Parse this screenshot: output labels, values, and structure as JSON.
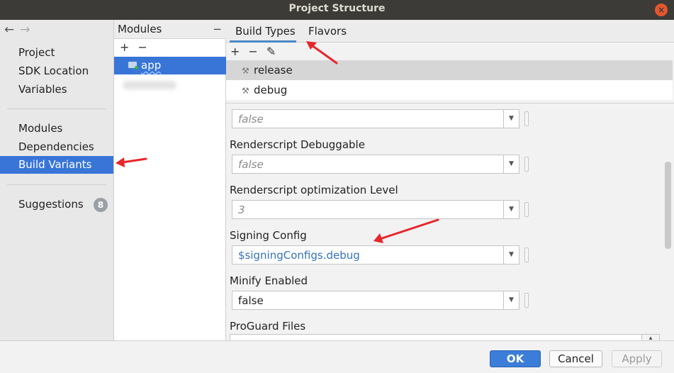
{
  "window": {
    "title": "Project Structure",
    "close_glyph": "×"
  },
  "nav": {
    "back_glyph": "←",
    "forward_glyph": "→",
    "items": [
      {
        "label": "Project"
      },
      {
        "label": "SDK Location"
      },
      {
        "label": "Variables"
      },
      {
        "label": "Modules"
      },
      {
        "label": "Dependencies"
      },
      {
        "label": "Build Variants",
        "selected": true
      },
      {
        "label": "Suggestions",
        "badge": "8"
      }
    ]
  },
  "modules": {
    "header": "Modules",
    "collapse_glyph": "−",
    "add_glyph": "+",
    "remove_glyph": "−",
    "items": [
      {
        "label": "app",
        "selected": true
      }
    ]
  },
  "tabs": [
    {
      "label": "Build Types",
      "active": true
    },
    {
      "label": "Flavors"
    }
  ],
  "build_types": {
    "add_glyph": "+",
    "remove_glyph": "−",
    "edit_glyph": "✎",
    "items": [
      {
        "label": "release",
        "selected": true
      },
      {
        "label": "debug"
      }
    ]
  },
  "properties": [
    {
      "label": "",
      "value": "false"
    },
    {
      "label": "Renderscript Debuggable",
      "value": "false"
    },
    {
      "label": "Renderscript optimization Level",
      "value": "3"
    },
    {
      "label": "Signing Config",
      "value": "$signingConfigs.debug"
    },
    {
      "label": "Minify Enabled",
      "value": "false"
    },
    {
      "label": "ProGuard Files",
      "value": ""
    }
  ],
  "footer": {
    "ok": "OK",
    "cancel": "Cancel",
    "apply": "Apply"
  },
  "colors": {
    "selection": "#3875d7",
    "annotation_arrow": "#e8262b",
    "link_value": "#3572c2"
  }
}
